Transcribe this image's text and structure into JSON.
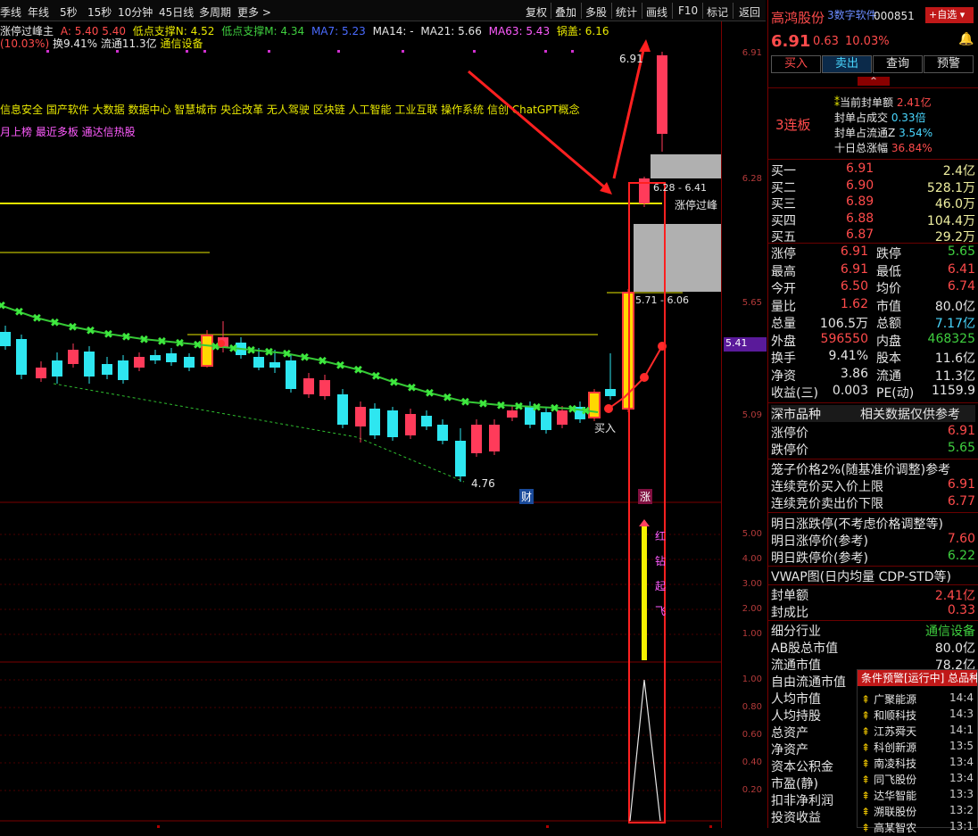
{
  "toolbar": {
    "left_items": [
      "季线",
      "年线",
      "5秒",
      "15秒",
      "10分钟",
      "45日线",
      "多周期",
      "更多 >"
    ],
    "right_items": [
      "复权",
      "叠加",
      "多股",
      "统计",
      "画线",
      "F10",
      "标记",
      "返回"
    ]
  },
  "chart_header": {
    "indicator_name": "涨停过峰主",
    "a_label": "A: 5.40",
    "a_val2": "5.40",
    "low1": "低点支撑N: 4.52",
    "low2": "低点支撑M: 4.34",
    "ma7": "MA7: 5.23",
    "ma14": "MA14: -",
    "ma21": "MA21: 5.66",
    "ma63": "MA63: 5.43",
    "pot": "锅盖: 6.16",
    "line2_pct": "(10.03%)",
    "line2_turn": "换9.41%",
    "line2_float": "流通11.3亿",
    "line2_industry": "通信设备",
    "concepts": "信息安全 国产软件 大数据 数据中心 智慧城市 央企改革 无人驾驶 区块链 人工智能 工业互联 操作系统 信创 ChatGPT概念",
    "tags": "月上榜 最近多板 通达信热股"
  },
  "chart_labels": {
    "price_high": "6.91",
    "range1": "6.28 - 6.41",
    "zt_peak": "涨停过峰",
    "range2": "5.71 - 6.06",
    "low_price": "4.76",
    "cai": "财",
    "buy": "买入",
    "zhang": "涨",
    "mark_hong": "红",
    "mark_zuan": "钻",
    "mark_qi": "起",
    "mark_fei": "飞",
    "current_price_tag": "5.41"
  },
  "yaxis": {
    "main": [
      "6.91",
      "6.28",
      "5.65",
      "5.09"
    ],
    "sub1": [
      "5.00",
      "4.00",
      "3.00",
      "2.00",
      "1.00"
    ],
    "sub2": [
      "1.00",
      "0.80",
      "0.60",
      "0.40",
      "0.20"
    ]
  },
  "stock": {
    "name": "高鸿股份",
    "tag": "3数字软件",
    "code": "000851",
    "add_btn": "+自选",
    "price": "6.91",
    "change": "0.63",
    "pct": "10.03%",
    "buy_btn": "买入",
    "sell_btn": "卖出",
    "query_btn": "查询",
    "alert_btn": "预警",
    "lianban": "3连板",
    "info": [
      {
        "label": "当前封单额",
        "value": "2.41亿"
      },
      {
        "label": "封单占成交",
        "value": "0.33倍"
      },
      {
        "label": "封单占流通Z",
        "value": "3.54%"
      },
      {
        "label": "十日总涨幅",
        "value": "36.84%"
      }
    ]
  },
  "orderbook": [
    {
      "label": "买一",
      "price": "6.91",
      "vol": "2.4亿"
    },
    {
      "label": "买二",
      "price": "6.90",
      "vol": "528.1万"
    },
    {
      "label": "买三",
      "price": "6.89",
      "vol": "46.0万"
    },
    {
      "label": "买四",
      "price": "6.88",
      "vol": "104.4万"
    },
    {
      "label": "买五",
      "price": "6.87",
      "vol": "29.2万"
    }
  ],
  "stats": [
    {
      "l1": "涨停",
      "v1": "6.91",
      "l2": "跌停",
      "v2": "5.65"
    },
    {
      "l1": "最高",
      "v1": "6.91",
      "l2": "最低",
      "v2": "6.41"
    },
    {
      "l1": "今开",
      "v1": "6.50",
      "l2": "均价",
      "v2": "6.74"
    },
    {
      "l1": "量比",
      "v1": "1.62",
      "l2": "市值",
      "v2": "80.0亿"
    },
    {
      "l1": "总量",
      "v1": "106.5万",
      "l2": "总额",
      "v2": "7.17亿"
    },
    {
      "l1": "外盘",
      "v1": "596550",
      "l2": "内盘",
      "v2": "468325"
    },
    {
      "l1": "换手",
      "v1": "9.41%",
      "l2": "股本",
      "v2": "11.6亿"
    },
    {
      "l1": "净资",
      "v1": "3.86",
      "l2": "流通",
      "v2": "11.3亿"
    },
    {
      "l1": "收益(三)",
      "v1": "0.003",
      "l2": "PE(动)",
      "v2": "1159.9"
    }
  ],
  "market": {
    "title": "深市品种",
    "note": "相关数据仅供参考"
  },
  "limits": [
    {
      "label": "涨停价",
      "value": "6.91"
    },
    {
      "label": "跌停价",
      "value": "5.65"
    }
  ],
  "cage": {
    "title": "笼子价格2%(随基准价调整)参考"
  },
  "auction": [
    {
      "label": "连续竞价买入价上限",
      "value": "6.91"
    },
    {
      "label": "连续竞价卖出价下限",
      "value": "6.77"
    }
  ],
  "tomorrow": {
    "title": "明日涨跌停(不考虑价格调整等)",
    "rows": [
      {
        "label": "明日涨停价(参考)",
        "value": "7.60"
      },
      {
        "label": "明日跌停价(参考)",
        "value": "6.22"
      }
    ]
  },
  "vwap": {
    "title": "VWAP图(日内均量 CDP-STD等)"
  },
  "seal": [
    {
      "label": "封单额",
      "value": "2.41亿"
    },
    {
      "label": "封成比",
      "value": "0.33"
    }
  ],
  "industry": [
    {
      "label": "细分行业",
      "value": "通信设备"
    },
    {
      "label": "AB股总市值",
      "value": "80.0亿"
    },
    {
      "label": "流通市值",
      "value": "78.2亿"
    },
    {
      "label": "自由流通市值",
      "value": ""
    },
    {
      "label": "人均市值",
      "value": ""
    },
    {
      "label": "人均持股",
      "value": ""
    },
    {
      "label": "总资产",
      "value": ""
    },
    {
      "label": "净资产",
      "value": ""
    },
    {
      "label": "资本公积金",
      "value": ""
    },
    {
      "label": "市盈(静)",
      "value": ""
    },
    {
      "label": "扣非净利润",
      "value": ""
    },
    {
      "label": "投资收益",
      "value": ""
    }
  ],
  "condition_alert": {
    "title": "条件预警[运行中] 总品种",
    "items": [
      {
        "name": "广聚能源",
        "time": "14:4"
      },
      {
        "name": "和顺科技",
        "time": "14:3"
      },
      {
        "name": "江苏舜天",
        "time": "14:1"
      },
      {
        "name": "科创新源",
        "time": "13:5"
      },
      {
        "name": "南凌科技",
        "time": "13:4"
      },
      {
        "name": "同飞股份",
        "time": "13:4"
      },
      {
        "name": "达华智能",
        "time": "13:3"
      },
      {
        "name": "溯联股份",
        "time": "13:2"
      },
      {
        "name": "高某智农",
        "time": "13:1"
      }
    ]
  },
  "colors": {
    "up": "#ff3b3b",
    "down": "#2ee6f0",
    "ma": "#36c936",
    "zt_line": "#e8e800"
  }
}
